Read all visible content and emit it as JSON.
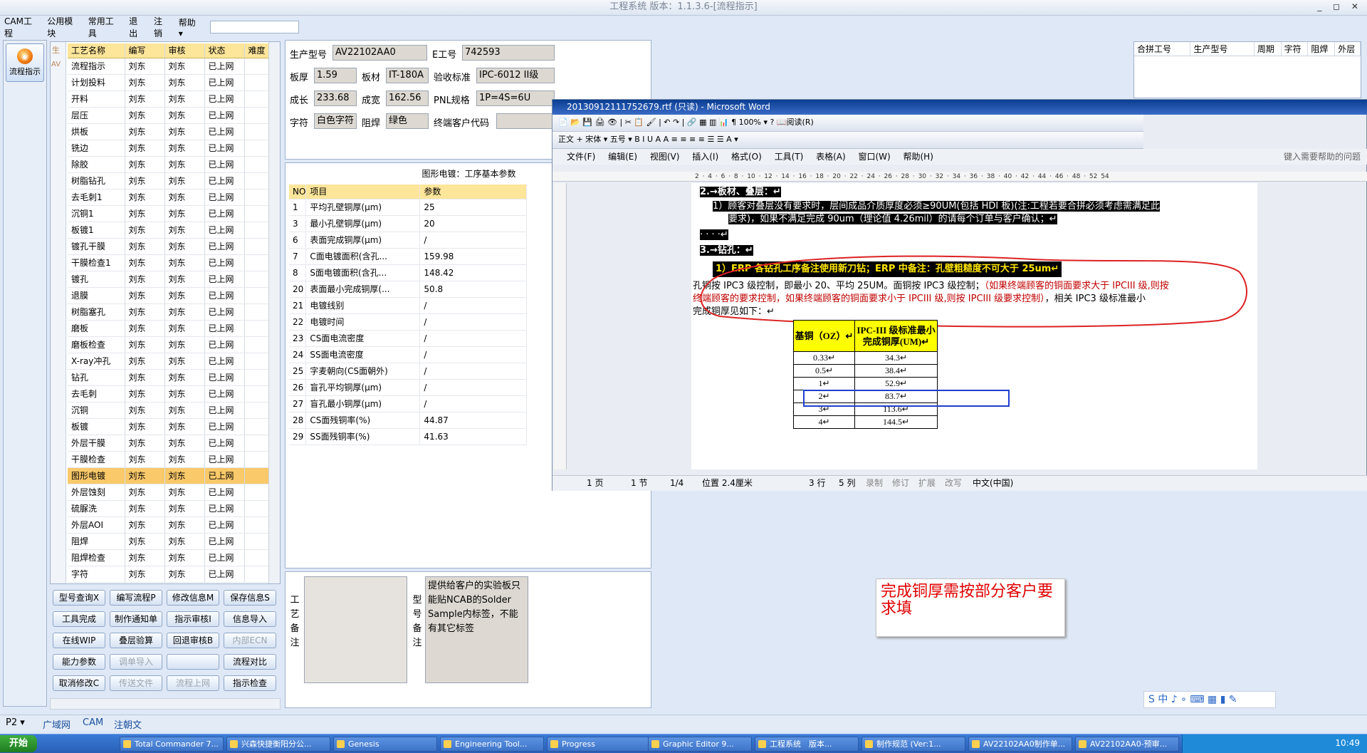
{
  "window": {
    "title": "工程系统 版本：1.1.3.6-[流程指示]",
    "controls": "_ ◻ ✕"
  },
  "menu": [
    "CAM工程",
    "公用模块",
    "常用工具",
    "退出",
    "注销",
    "帮助 ▾"
  ],
  "nav": {
    "label": "流程指示"
  },
  "process": {
    "headers": [
      "工艺名称",
      "编写",
      "审核",
      "状态",
      "难度"
    ],
    "rows": [
      [
        "流程指示",
        "刘东",
        "刘东",
        "已上网"
      ],
      [
        "计划投料",
        "刘东",
        "刘东",
        "已上网"
      ],
      [
        "开料",
        "刘东",
        "刘东",
        "已上网"
      ],
      [
        "层压",
        "刘东",
        "刘东",
        "已上网"
      ],
      [
        "烘板",
        "刘东",
        "刘东",
        "已上网"
      ],
      [
        "铣边",
        "刘东",
        "刘东",
        "已上网"
      ],
      [
        "除胶",
        "刘东",
        "刘东",
        "已上网"
      ],
      [
        "树脂钻孔",
        "刘东",
        "刘东",
        "已上网"
      ],
      [
        "去毛刺1",
        "刘东",
        "刘东",
        "已上网"
      ],
      [
        "沉铜1",
        "刘东",
        "刘东",
        "已上网"
      ],
      [
        "板镀1",
        "刘东",
        "刘东",
        "已上网"
      ],
      [
        "镀孔干膜",
        "刘东",
        "刘东",
        "已上网"
      ],
      [
        "干膜检查1",
        "刘东",
        "刘东",
        "已上网"
      ],
      [
        "镀孔",
        "刘东",
        "刘东",
        "已上网"
      ],
      [
        "退膜",
        "刘东",
        "刘东",
        "已上网"
      ],
      [
        "树脂塞孔",
        "刘东",
        "刘东",
        "已上网"
      ],
      [
        "磨板",
        "刘东",
        "刘东",
        "已上网"
      ],
      [
        "磨板检查",
        "刘东",
        "刘东",
        "已上网"
      ],
      [
        "X-ray冲孔",
        "刘东",
        "刘东",
        "已上网"
      ],
      [
        "钻孔",
        "刘东",
        "刘东",
        "已上网"
      ],
      [
        "去毛刺",
        "刘东",
        "刘东",
        "已上网"
      ],
      [
        "沉铜",
        "刘东",
        "刘东",
        "已上网"
      ],
      [
        "板镀",
        "刘东",
        "刘东",
        "已上网"
      ],
      [
        "外层干膜",
        "刘东",
        "刘东",
        "已上网"
      ],
      [
        "干膜检查",
        "刘东",
        "刘东",
        "已上网"
      ],
      [
        "图形电镀",
        "刘东",
        "刘东",
        "已上网"
      ],
      [
        "外层蚀刻",
        "刘东",
        "刘东",
        "已上网"
      ],
      [
        "硫脲洗",
        "刘东",
        "刘东",
        "已上网"
      ],
      [
        "外层AOI",
        "刘东",
        "刘东",
        "已上网"
      ],
      [
        "阻焊",
        "刘东",
        "刘东",
        "已上网"
      ],
      [
        "阻焊检查",
        "刘东",
        "刘东",
        "已上网"
      ],
      [
        "字符",
        "刘东",
        "刘东",
        "已上网"
      ]
    ],
    "selected_index": 25,
    "gutter": [
      "生",
      "AV"
    ]
  },
  "buttons": [
    {
      "label": "型号查询X",
      "enabled": true
    },
    {
      "label": "编写流程P",
      "enabled": true
    },
    {
      "label": "修改信息M",
      "enabled": true
    },
    {
      "label": "保存信息S",
      "enabled": true
    },
    {
      "label": "工具完成",
      "enabled": true
    },
    {
      "label": "制作通知单",
      "enabled": true
    },
    {
      "label": "指示审核I",
      "enabled": true
    },
    {
      "label": "信息导入",
      "enabled": true
    },
    {
      "label": "在线WIP",
      "enabled": true
    },
    {
      "label": "叠层验算",
      "enabled": true
    },
    {
      "label": "回退审核B",
      "enabled": true
    },
    {
      "label": "内部ECN",
      "enabled": false
    },
    {
      "label": "能力参数",
      "enabled": true
    },
    {
      "label": "调单导入",
      "enabled": false
    },
    {
      "label": "",
      "enabled": false
    },
    {
      "label": "流程对比",
      "enabled": true
    },
    {
      "label": "取消修改C",
      "enabled": true
    },
    {
      "label": "传送文件",
      "enabled": false
    },
    {
      "label": "流程上网",
      "enabled": false
    },
    {
      "label": "指示检查",
      "enabled": true
    }
  ],
  "info": {
    "model_label": "生产型号",
    "model": "AV22102AA0",
    "e_label": "E工号",
    "e_no": "742593",
    "thick_label": "板厚",
    "thick": "1.59",
    "mat_label": "板材",
    "mat": "IT-180A",
    "std_label": "验收标准",
    "std": "IPC-6012 II级",
    "len_label": "成长",
    "len": "233.68",
    "wid_label": "成宽",
    "wid": "162.56",
    "pnl_label": "PNL规格",
    "pnl": "1P=4S=6U",
    "char_label": "字符",
    "char": "白色字符",
    "mask_label": "阻焊",
    "mask": "绿色",
    "cust_label": "终端客户代码",
    "cust": ""
  },
  "params": {
    "title": "图形电镀：工序基本参数",
    "headers": [
      "NO",
      "项目",
      "参数"
    ],
    "rows": [
      [
        "1",
        "平均孔壁铜厚(μm)",
        "25"
      ],
      [
        "3",
        "最小孔壁铜厚(μm)",
        "20"
      ],
      [
        "6",
        "表面完成铜厚(μm)",
        "/"
      ],
      [
        "7",
        "C面电镀面积(含孔...",
        "159.98"
      ],
      [
        "8",
        "S面电镀面积(含孔...",
        "148.42"
      ],
      [
        "20",
        "表面最小完成铜厚(...",
        "50.8"
      ],
      [
        "21",
        "电镀线别",
        "/"
      ],
      [
        "22",
        "电镀时间",
        "/"
      ],
      [
        "23",
        "CS面电流密度",
        "/"
      ],
      [
        "24",
        "SS面电流密度",
        "/"
      ],
      [
        "25",
        "字麦朝向(CS面朝外)",
        "/"
      ],
      [
        "26",
        "盲孔平均铜厚(μm)",
        "/"
      ],
      [
        "27",
        "盲孔最小铜厚(μm)",
        "/"
      ],
      [
        "28",
        "CS面残铜率(%)",
        "44.87"
      ],
      [
        "29",
        "SS面残铜率(%)",
        "41.63"
      ]
    ]
  },
  "remarks": {
    "process_label": "工艺备注",
    "model_label": "型号备注",
    "model_text": "提供给客户的实验板只能贴NCAB的Solder Sample内标签，不能有其它标签"
  },
  "topright": {
    "headers": [
      "合拼工号",
      "生产型号",
      "周期",
      "字符",
      "阻焊",
      "外层"
    ]
  },
  "word": {
    "title": "20130912111752679.rtf (只读) - Microsoft Word",
    "tool1": "📄 📂 💾 🖨 👁 | ✂ 📋 🖌 | ↶ ↷ | 🔗 ▦ ▥ 📊 ¶ 100% ▾ ? 📖阅读(R)",
    "tool2": "正文 + 宋体 ▾        五号 ▾  B  I  U  A  A  ≡ ≡ ≡ ≡  ☰ ☰  A ▾",
    "menu": "文件(F) 编辑(E) 视图(V) 插入(I) 格式(O) 工具(T) 表格(A) 窗口(W) 帮助(H)",
    "help_box": "键入需要帮助的问题",
    "ruler": "2 · 4 · 6 · 8 · 10 · 12 · 14 · 16 · 18 · 20 · 22 · 24 · 26 · 28 · 30 · 32 · 34 · 36 · 38 · 40 · 42 · 44 · 46 · 48 · 52 54",
    "lines": [
      "2.→板材、叠层：↵",
      "1）顾客对叠层没有要求时，层间成品介质厚度必须≥90UM(包括 HDI 板)(注:工程若要合拼必须考虑需满足此",
      "要求)，如果不满足完成 90um（理论值 4.26mil）的请每个订单与客户确认；↵",
      "· · · ·↵",
      "3.→钻孔：↵",
      "1）ERP 各钻孔工序备注使用新刀钻；ERP 中备注：孔壁粗糙度不可大于 25um↵",
      "孔铜按 IPC3 级控制，即最小 20、平均 25UM。面铜按 IPC3 级控制；",
      "（如果终端顾客的铜面要求大于 IPCIII 级,则按",
      "终端顾客的要求控制，如果终端顾客的铜面要求小于 IPCIII 级,则按 IPCIII 级要求控制）",
      "，相关 IPC3 级标准最小",
      "完成铜厚见如下：↵"
    ],
    "table": {
      "headers": [
        "基铜（OZ）↵",
        "IPC-III 级标准最小完成铜厚(UM)↵"
      ],
      "rows": [
        [
          "0.33↵",
          "34.3↵"
        ],
        [
          "0.5↵",
          "38.4↵"
        ],
        [
          "1↵",
          "52.9↵"
        ],
        [
          "2↵",
          "83.7↵"
        ],
        [
          "3↵",
          "113.6↵"
        ],
        [
          "4↵",
          "144.5↵"
        ]
      ]
    },
    "status": [
      "1 页",
      "1 节",
      "1/4",
      "位置 2.4厘米",
      "3 行",
      "5 列",
      "录制",
      "修订",
      "扩展",
      "改写",
      "中文(中国)"
    ]
  },
  "note": "完成铜厚需按部分客户要求填",
  "bottom_tabs": [
    "P2 ▾",
    "广域网",
    "CAM",
    "注朝文"
  ],
  "taskbar": {
    "start": "开始",
    "tasks": [
      "Total Commander 7...",
      "兴森快捷衡阳分公...",
      "Genesis",
      "Engineering Tool...",
      "Progress",
      "Graphic Editor 9...",
      "工程系统　版本...",
      "制作规范 (Ver:1...",
      "AV22102AA0制作单...",
      "AV22102AA0-预审..."
    ],
    "clock": "10:49"
  },
  "ime": "S 中 ♪ ∘ ⌨ ▦ ▮ ✎",
  "colors": {
    "header_yellow": "#fde59a",
    "selected_row": "#f9c96a",
    "word_title": "#0a3d91",
    "note_red": "#e00000",
    "annotation_red": "#d22",
    "annotation_blue": "#1f3fd0"
  }
}
